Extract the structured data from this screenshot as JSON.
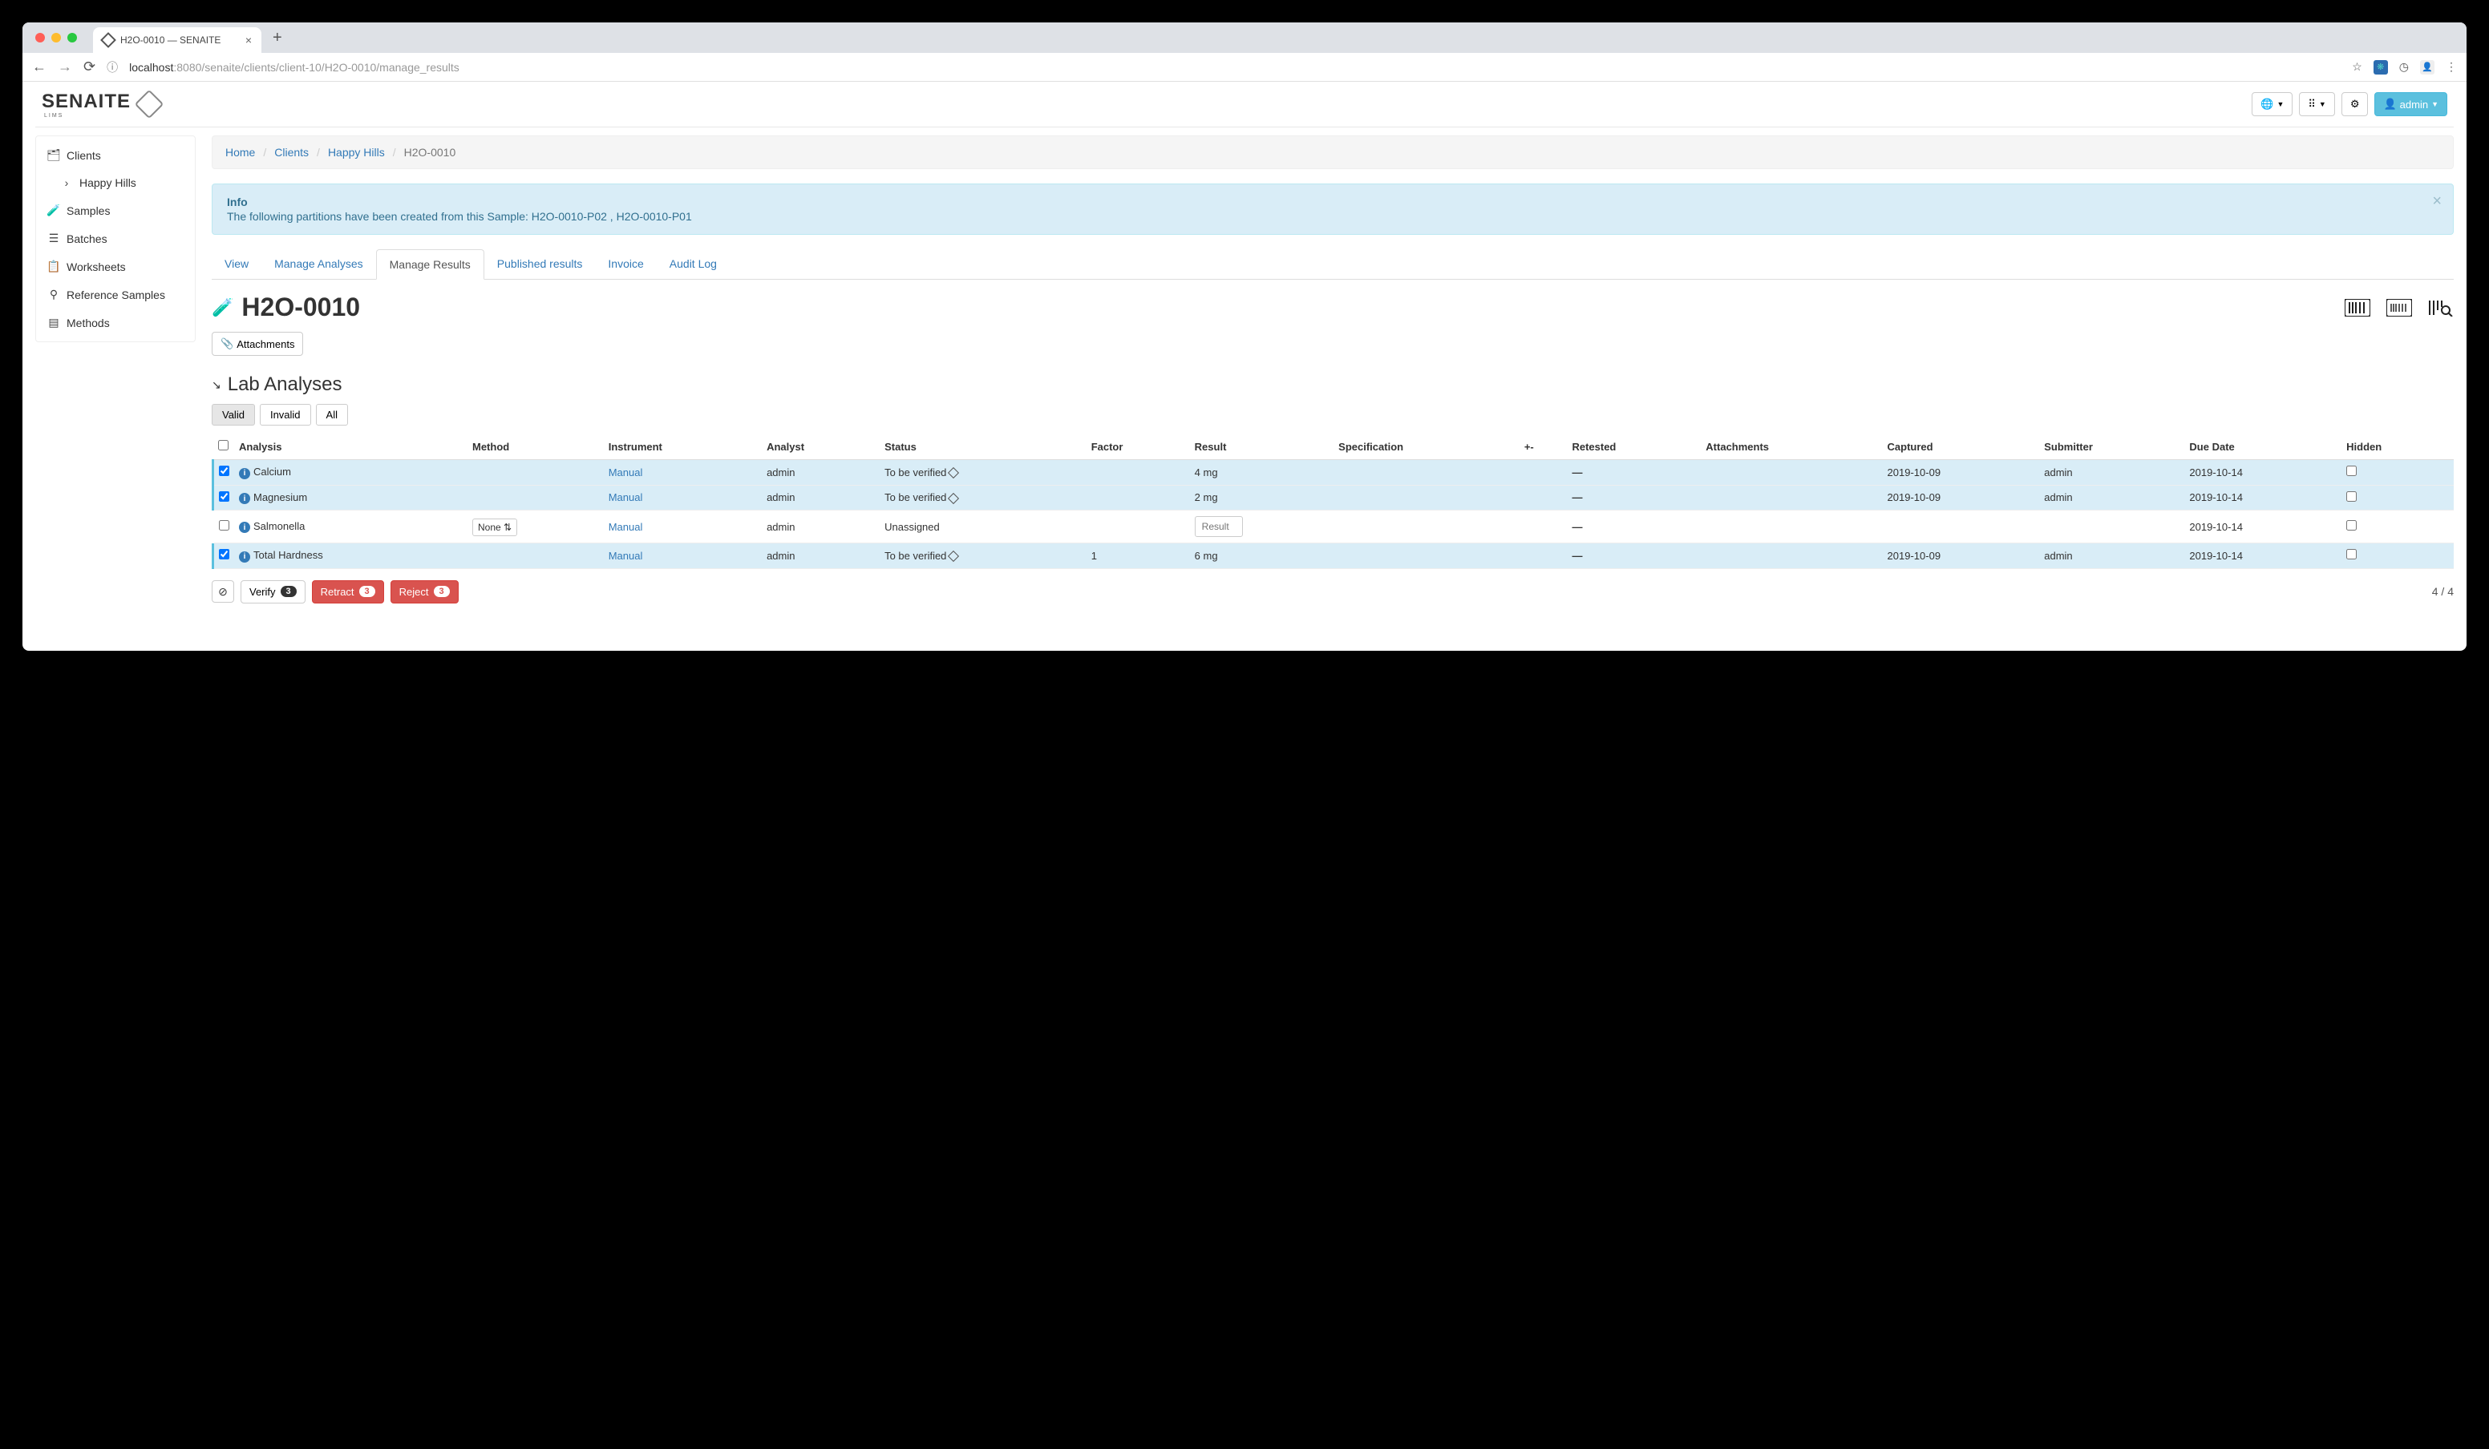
{
  "browser": {
    "tab_title": "H2O-0010 — SENAITE",
    "url_pre": "localhost",
    "url_post": ":8080/senaite/clients/client-10/H2O-0010/manage_results"
  },
  "header": {
    "logo_text": "SENAITE",
    "logo_sub": "LIMS",
    "user_label": "admin"
  },
  "sidebar": {
    "items": [
      {
        "label": "Clients",
        "icon": "address-card"
      },
      {
        "label": "Happy Hills",
        "icon": "chevron",
        "sub": true
      },
      {
        "label": "Samples",
        "icon": "vial"
      },
      {
        "label": "Batches",
        "icon": "layers"
      },
      {
        "label": "Worksheets",
        "icon": "clipboard"
      },
      {
        "label": "Reference Samples",
        "icon": "marker"
      },
      {
        "label": "Methods",
        "icon": "list"
      }
    ]
  },
  "breadcrumb": [
    "Home",
    "Clients",
    "Happy Hills",
    "H2O-0010"
  ],
  "alert": {
    "title": "Info",
    "body": "The following partitions have been created from this Sample: H2O-0010-P02 , H2O-0010-P01"
  },
  "tabs": [
    "View",
    "Manage Analyses",
    "Manage Results",
    "Published results",
    "Invoice",
    "Audit Log"
  ],
  "active_tab": "Manage Results",
  "page_title": "H2O-0010",
  "attachments_label": "Attachments",
  "section_title": "Lab Analyses",
  "filters": [
    "Valid",
    "Invalid",
    "All"
  ],
  "active_filter": "Valid",
  "columns": [
    "Analysis",
    "Method",
    "Instrument",
    "Analyst",
    "Status",
    "Factor",
    "Result",
    "Specification",
    "+-",
    "Retested",
    "Attachments",
    "Captured",
    "Submitter",
    "Due Date",
    "Hidden"
  ],
  "rows": [
    {
      "checked": true,
      "analysis": "Calcium",
      "method": "",
      "instrument": "Manual",
      "analyst": "admin",
      "status": "To be verified",
      "status_diamond": true,
      "factor": "",
      "result": "4 mg",
      "retested": "—",
      "captured": "2019-10-09",
      "submitter": "admin",
      "due": "2019-10-14"
    },
    {
      "checked": true,
      "analysis": "Magnesium",
      "method": "",
      "instrument": "Manual",
      "analyst": "admin",
      "status": "To be verified",
      "status_diamond": true,
      "factor": "",
      "result": "2 mg",
      "retested": "—",
      "captured": "2019-10-09",
      "submitter": "admin",
      "due": "2019-10-14"
    },
    {
      "checked": false,
      "analysis": "Salmonella",
      "method_select": "None",
      "instrument": "Manual",
      "analyst": "admin",
      "status": "Unassigned",
      "status_diamond": false,
      "factor": "",
      "result_input": true,
      "result_placeholder": "Result",
      "retested": "—",
      "captured": "",
      "submitter": "",
      "due": "2019-10-14"
    },
    {
      "checked": true,
      "analysis": "Total Hardness",
      "method": "",
      "instrument": "Manual",
      "analyst": "admin",
      "status": "To be verified",
      "status_diamond": true,
      "factor": "1",
      "result": "6 mg",
      "retested": "—",
      "captured": "2019-10-09",
      "submitter": "admin",
      "due": "2019-10-14"
    }
  ],
  "actions": {
    "verify": {
      "label": "Verify",
      "count": "3"
    },
    "retract": {
      "label": "Retract",
      "count": "3"
    },
    "reject": {
      "label": "Reject",
      "count": "3"
    }
  },
  "pagination": "4 / 4"
}
